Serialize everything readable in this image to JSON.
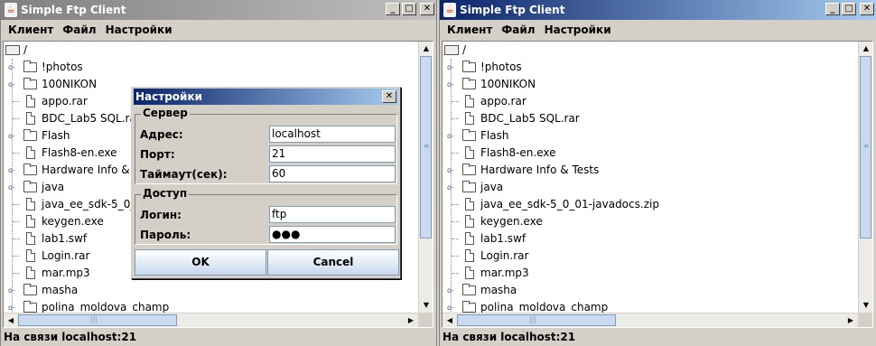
{
  "left_window": {
    "title": "Simple Ftp Client",
    "menu": [
      "Клиент",
      "Файл",
      "Настройки"
    ],
    "tree_root": "/",
    "tree_items": [
      {
        "type": "folder",
        "label": "!photos"
      },
      {
        "type": "folder",
        "label": "100NIKON"
      },
      {
        "type": "file",
        "label": "appo.rar"
      },
      {
        "type": "file",
        "label": "BDC_Lab5 SQL.rar"
      },
      {
        "type": "folder",
        "label": "Flash"
      },
      {
        "type": "file",
        "label": "Flash8-en.exe"
      },
      {
        "type": "folder",
        "label": "Hardware Info & Tests"
      },
      {
        "type": "folder",
        "label": "java"
      },
      {
        "type": "file",
        "label": "java_ee_sdk-5_0_01-javadocs.zip"
      },
      {
        "type": "file",
        "label": "keygen.exe"
      },
      {
        "type": "file",
        "label": "lab1.swf"
      },
      {
        "type": "file",
        "label": "Login.rar"
      },
      {
        "type": "file",
        "label": "mar.mp3"
      },
      {
        "type": "folder",
        "label": "masha"
      },
      {
        "type": "folder",
        "label": "polina_moldova_champ"
      }
    ],
    "status": "На связи localhost:21"
  },
  "right_window": {
    "title": "Simple Ftp Client",
    "menu": [
      "Клиент",
      "Файл",
      "Настройки"
    ],
    "tree_root": "/",
    "tree_items": [
      {
        "type": "folder",
        "label": "!photos"
      },
      {
        "type": "folder",
        "label": "100NIKON"
      },
      {
        "type": "file",
        "label": "appo.rar"
      },
      {
        "type": "file",
        "label": "BDC_Lab5 SQL.rar"
      },
      {
        "type": "folder",
        "label": "Flash"
      },
      {
        "type": "file",
        "label": "Flash8-en.exe"
      },
      {
        "type": "folder",
        "label": "Hardware Info & Tests"
      },
      {
        "type": "folder",
        "label": "java"
      },
      {
        "type": "file",
        "label": "java_ee_sdk-5_0_01-javadocs.zip"
      },
      {
        "type": "file",
        "label": "keygen.exe"
      },
      {
        "type": "file",
        "label": "lab1.swf"
      },
      {
        "type": "file",
        "label": "Login.rar"
      },
      {
        "type": "file",
        "label": "mar.mp3"
      },
      {
        "type": "folder",
        "label": "masha"
      },
      {
        "type": "folder",
        "label": "polina_moldova_champ"
      }
    ],
    "status": "На связи localhost:21"
  },
  "dialog": {
    "title": "Настройки",
    "server_group": "Сервер",
    "address_label": "Адрес:",
    "address_value": "localhost",
    "port_label": "Порт:",
    "port_value": "21",
    "timeout_label": "Таймаут(сек):",
    "timeout_value": "60",
    "access_group": "Доступ",
    "login_label": "Логин:",
    "login_value": "ftp",
    "password_label": "Пароль:",
    "password_value": "●●●",
    "ok_label": "OK",
    "cancel_label": "Cancel"
  },
  "colors": {
    "active_title": "#0a246a",
    "inactive_title": "#808080",
    "window_bg": "#d4d0c8"
  }
}
